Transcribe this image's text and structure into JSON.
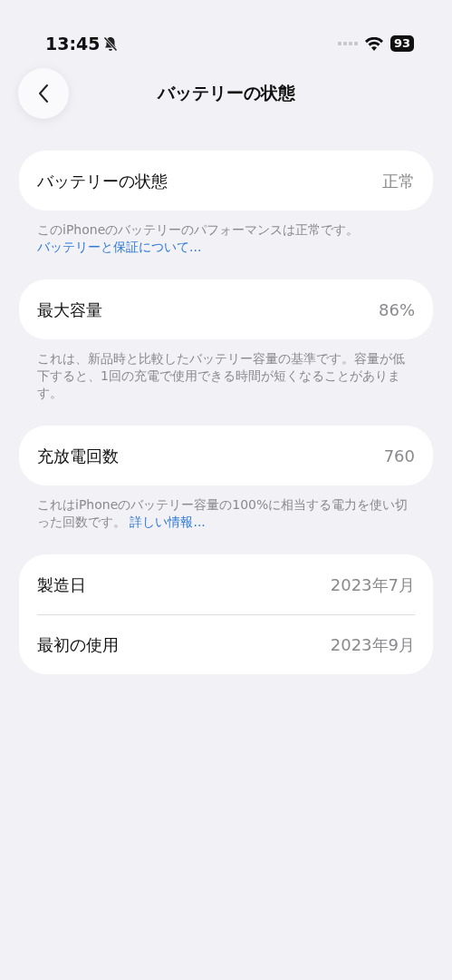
{
  "status_bar": {
    "time": "13:45",
    "battery": "93"
  },
  "nav": {
    "title": "バッテリーの状態"
  },
  "sections": [
    {
      "rows": [
        {
          "label": "バッテリーの状態",
          "value": "正常"
        }
      ],
      "footer": {
        "text": "このiPhoneのバッテリーのパフォーマンスは正常です。",
        "link": "バッテリーと保証について..."
      }
    },
    {
      "rows": [
        {
          "label": "最大容量",
          "value": "86%"
        }
      ],
      "footer": {
        "text": "これは、新品時と比較したバッテリー容量の基準です。容量が低下すると、1回の充電で使用できる時間が短くなることがあります。"
      }
    },
    {
      "rows": [
        {
          "label": "充放電回数",
          "value": "760"
        }
      ],
      "footer": {
        "text": "これはiPhoneのバッテリー容量の100%に相当する電力を使い切った回数です。",
        "link": "詳しい情報..."
      }
    },
    {
      "rows": [
        {
          "label": "製造日",
          "value": "2023年7月"
        },
        {
          "label": "最初の使用",
          "value": "2023年9月"
        }
      ]
    }
  ]
}
